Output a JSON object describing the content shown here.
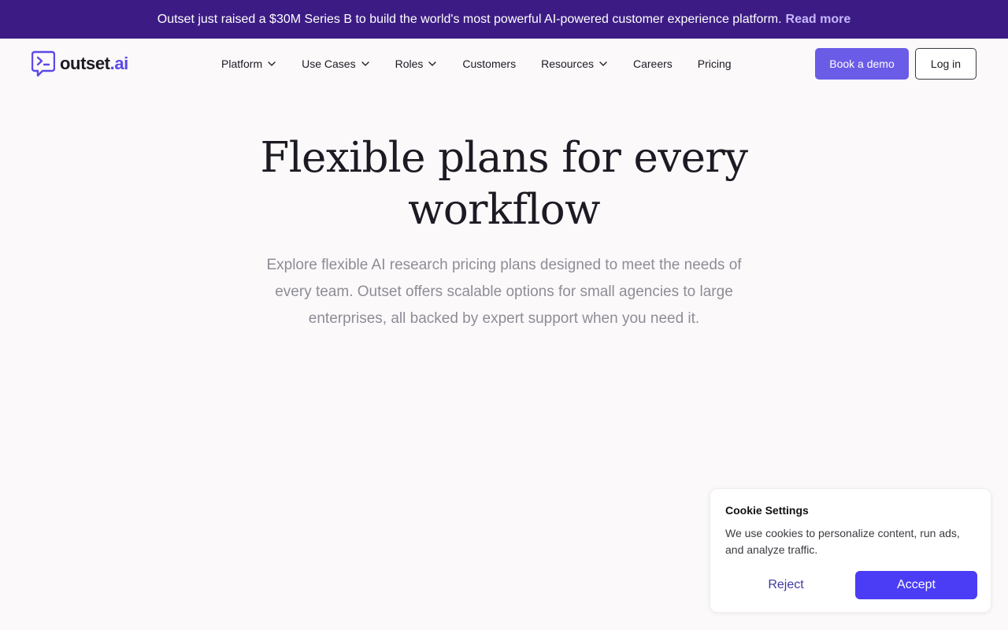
{
  "announcement": {
    "message": "Outset just raised a $30M Series B to build the world's most powerful AI-powered customer experience platform.",
    "link_label": "Read more"
  },
  "header": {
    "logo": {
      "word": "outset",
      "dot": ".",
      "tld": "ai"
    },
    "nav": [
      {
        "label": "Platform",
        "has_dropdown": true,
        "icon": "chevron-down-icon"
      },
      {
        "label": "Use Cases",
        "has_dropdown": true,
        "icon": "chevron-down-icon"
      },
      {
        "label": "Roles",
        "has_dropdown": true,
        "icon": "chevron-down-icon"
      },
      {
        "label": "Customers",
        "has_dropdown": false
      },
      {
        "label": "Resources",
        "has_dropdown": true,
        "icon": "chevron-down-icon"
      },
      {
        "label": "Careers",
        "has_dropdown": false
      },
      {
        "label": "Pricing",
        "has_dropdown": false
      }
    ],
    "cta_label": "Book a demo",
    "login_label": "Log in"
  },
  "hero": {
    "title_line1": "Flexible plans for every",
    "title_line2": "workflow",
    "subtitle": "Explore flexible AI research pricing plans designed to meet the needs of every team. Outset offers scalable options for small agencies to large enterprises, all backed by expert support when you need it."
  },
  "cookie_banner": {
    "title": "Cookie Settings",
    "text": "We use cookies to personalize content, run ads, and analyze traffic.",
    "reject_label": "Reject",
    "accept_label": "Accept"
  },
  "colors": {
    "announcement_bg": "#3c1c84",
    "announcement_link": "#c6b6ff",
    "brand_accent": "#5b49e8",
    "demo_button": "#6b5ce7",
    "accept_button": "#4a3df5",
    "page_bg": "#fbf9fa"
  }
}
